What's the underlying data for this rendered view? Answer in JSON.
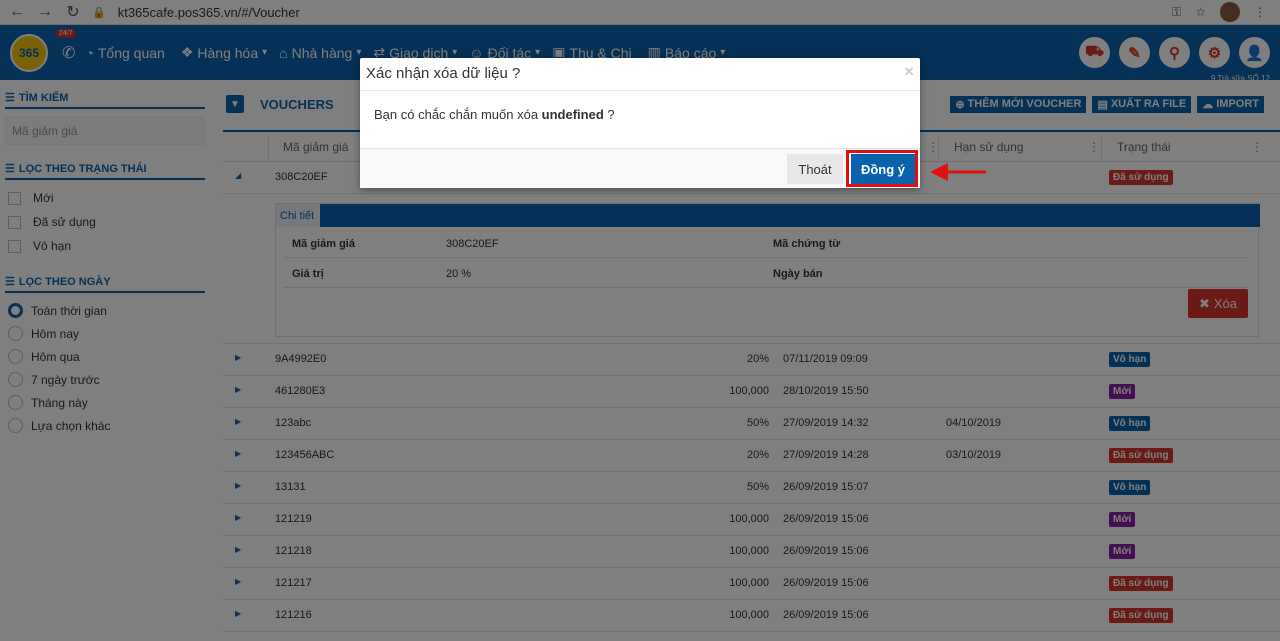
{
  "browser": {
    "url": "kt365cafe.pos365.vn/#/Voucher"
  },
  "topbar": {
    "badge": "24/7",
    "menu": [
      {
        "label": "Tổng quan",
        "caret": ""
      },
      {
        "label": "Hàng hóa",
        "caret": "▾"
      },
      {
        "label": "Nhà hàng",
        "caret": "▾"
      },
      {
        "label": "Giao dịch",
        "caret": "▾"
      },
      {
        "label": "Đối tác",
        "caret": "▾"
      },
      {
        "label": "Thu & Chi",
        "caret": ""
      },
      {
        "label": "Báo cáo",
        "caret": "▾"
      }
    ],
    "store": "9 Trà sữa SỐ 12"
  },
  "sidebar": {
    "search_title": "TÌM KIẾM",
    "search_placeholder": "Mã giảm giá",
    "status_title": "LỌC THEO TRẠNG THÁI",
    "status_options": [
      "Mới",
      "Đã sử dụng",
      "Vô hạn"
    ],
    "date_title": "LỌC THEO NGÀY",
    "date_options": [
      "Toàn thời gian",
      "Hôm nay",
      "Hôm qua",
      "7 ngày trước",
      "Tháng này",
      "Lựa chọn khác"
    ]
  },
  "page": {
    "title": "VOUCHERS",
    "add_btn": "THÊM MỚI VOUCHER",
    "export_btn": "XUẤT RA FILE",
    "import_btn": "IMPORT"
  },
  "grid": {
    "headers": {
      "code": "Mã giảm giá",
      "expiry": "Hạn sử dụng",
      "status": "Trạng thái"
    },
    "expanded_row": {
      "code": "308C20EF",
      "status": "Đã sử dụng"
    },
    "detail": {
      "tab": "Chi tiết",
      "code_label": "Mã giảm giá",
      "code_value": "308C20EF",
      "value_label": "Giá trị",
      "value_value": "20 %",
      "voucher_label": "Mã chứng từ",
      "sale_label": "Ngày bán",
      "delete_btn": "Xóa"
    },
    "rows": [
      {
        "code": "9A4992E0",
        "value": "20%",
        "date": "07/11/2019 09:09",
        "expiry": "",
        "status": "Vô hạn"
      },
      {
        "code": "461280E3",
        "value": "100,000",
        "date": "28/10/2019 15:50",
        "expiry": "",
        "status": "Mới"
      },
      {
        "code": "123abc",
        "value": "50%",
        "date": "27/09/2019 14:32",
        "expiry": "04/10/2019",
        "status": "Vô hạn"
      },
      {
        "code": "123456ABC",
        "value": "20%",
        "date": "27/09/2019 14:28",
        "expiry": "03/10/2019",
        "status": "Đã sử dụng"
      },
      {
        "code": "13131",
        "value": "50%",
        "date": "26/09/2019 15:07",
        "expiry": "",
        "status": "Vô hạn"
      },
      {
        "code": "121219",
        "value": "100,000",
        "date": "26/09/2019 15:06",
        "expiry": "",
        "status": "Mới"
      },
      {
        "code": "121218",
        "value": "100,000",
        "date": "26/09/2019 15:06",
        "expiry": "",
        "status": "Mới"
      },
      {
        "code": "121217",
        "value": "100,000",
        "date": "26/09/2019 15:06",
        "expiry": "",
        "status": "Đã sử dụng"
      },
      {
        "code": "121216",
        "value": "100,000",
        "date": "26/09/2019 15:06",
        "expiry": "",
        "status": "Đã sử dụng"
      }
    ]
  },
  "modal": {
    "title": "Xác nhận xóa dữ liệu ?",
    "message_prefix": "Bạn có chắc chắn muốn xóa ",
    "message_bold": "undefined",
    "message_suffix": " ?",
    "cancel": "Thoát",
    "confirm": "Đồng ý"
  },
  "colors": {
    "primary": "#0b62ac",
    "danger": "#d9342b",
    "infinite": "#0b62ac",
    "new": "#8e1fa3",
    "used": "#d9342b"
  }
}
